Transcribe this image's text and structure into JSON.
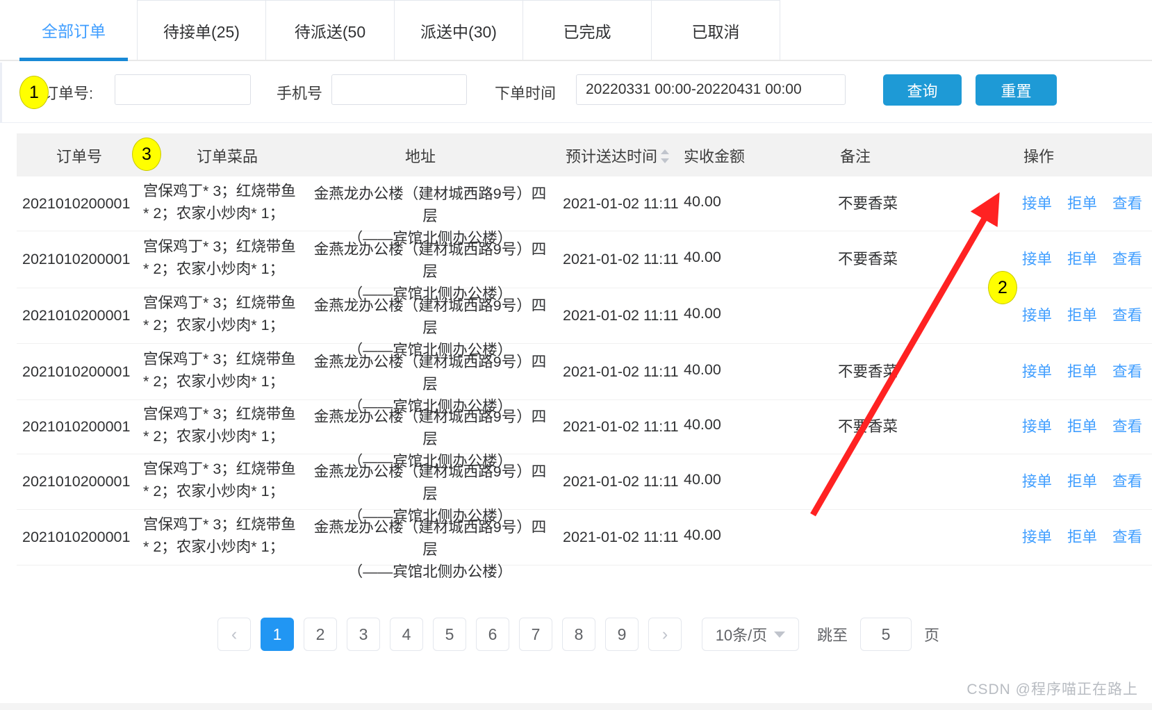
{
  "tabs": [
    {
      "label": "全部订单",
      "active": true
    },
    {
      "label": "待接单(25)",
      "active": false
    },
    {
      "label": "待派送(50",
      "active": false
    },
    {
      "label": "派送中(30)",
      "active": false
    },
    {
      "label": "已完成",
      "active": false
    },
    {
      "label": "已取消",
      "active": false
    }
  ],
  "filter": {
    "order_no_label": "订单号:",
    "order_no_value": "",
    "order_no_placeholder": "",
    "phone_label": "手机号",
    "phone_value": "",
    "phone_placeholder": "",
    "time_label": "下单时间",
    "time_value": "20220331 00:00-20220431 00:00",
    "time_placeholder": "",
    "query_button": "查询",
    "reset_button": "重置"
  },
  "annotations": {
    "badge1": "1",
    "badge2": "2",
    "badge3": "3",
    "badge_color": "#FFFF00",
    "arrow_color": "#FF2222"
  },
  "table": {
    "headers": {
      "order_no": "订单号",
      "dishes": "订单菜品",
      "address": "地址",
      "eta": "预计送达时间",
      "amount": "实收金额",
      "remark": "备注",
      "actions": "操作"
    },
    "actions": {
      "accept": "接单",
      "reject": "拒单",
      "view": "查看"
    },
    "rows": [
      {
        "order_no": "2021010200001",
        "dishes": "宫保鸡丁* 3；红烧带鱼* 2；农家小炒肉* 1；",
        "address_line1": "金燕龙办公楼（建材城西路9号）四层",
        "address_line2": "（——宾馆北侧办公楼）",
        "eta": "2021-01-02 11:11",
        "amount": "40.00",
        "remark": "不要香菜"
      },
      {
        "order_no": "2021010200001",
        "dishes": "宫保鸡丁* 3；红烧带鱼* 2；农家小炒肉* 1；",
        "address_line1": "金燕龙办公楼（建材城西路9号）四层",
        "address_line2": "（——宾馆北侧办公楼）",
        "eta": "2021-01-02 11:11",
        "amount": "40.00",
        "remark": "不要香菜"
      },
      {
        "order_no": "2021010200001",
        "dishes": "宫保鸡丁* 3；红烧带鱼* 2；农家小炒肉* 1；",
        "address_line1": "金燕龙办公楼（建材城西路9号）四层",
        "address_line2": "（——宾馆北侧办公楼）",
        "eta": "2021-01-02 11:11",
        "amount": "40.00",
        "remark": ""
      },
      {
        "order_no": "2021010200001",
        "dishes": "宫保鸡丁* 3；红烧带鱼* 2；农家小炒肉* 1；",
        "address_line1": "金燕龙办公楼（建材城西路9号）四层",
        "address_line2": "（——宾馆北侧办公楼）",
        "eta": "2021-01-02 11:11",
        "amount": "40.00",
        "remark": "不要香菜"
      },
      {
        "order_no": "2021010200001",
        "dishes": "宫保鸡丁* 3；红烧带鱼* 2；农家小炒肉* 1；",
        "address_line1": "金燕龙办公楼（建材城西路9号）四层",
        "address_line2": "（——宾馆北侧办公楼）",
        "eta": "2021-01-02 11:11",
        "amount": "40.00",
        "remark": "不要香菜"
      },
      {
        "order_no": "2021010200001",
        "dishes": "宫保鸡丁* 3；红烧带鱼* 2；农家小炒肉* 1；",
        "address_line1": "金燕龙办公楼（建材城西路9号）四层",
        "address_line2": "（——宾馆北侧办公楼）",
        "eta": "2021-01-02 11:11",
        "amount": "40.00",
        "remark": ""
      },
      {
        "order_no": "2021010200001",
        "dishes": "宫保鸡丁* 3；红烧带鱼* 2；农家小炒肉* 1；",
        "address_line1": "金燕龙办公楼（建材城西路9号）四层",
        "address_line2": "（——宾馆北侧办公楼）",
        "eta": "2021-01-02 11:11",
        "amount": "40.00",
        "remark": ""
      }
    ]
  },
  "pagination": {
    "prev": "‹",
    "next": "›",
    "pages": [
      "1",
      "2",
      "3",
      "4",
      "5",
      "6",
      "7",
      "8",
      "9"
    ],
    "current": "1",
    "page_size": "10条/页",
    "jump_label": "跳至",
    "jump_value": "5",
    "jump_unit": "页"
  },
  "watermark": "CSDN @程序喵正在路上"
}
